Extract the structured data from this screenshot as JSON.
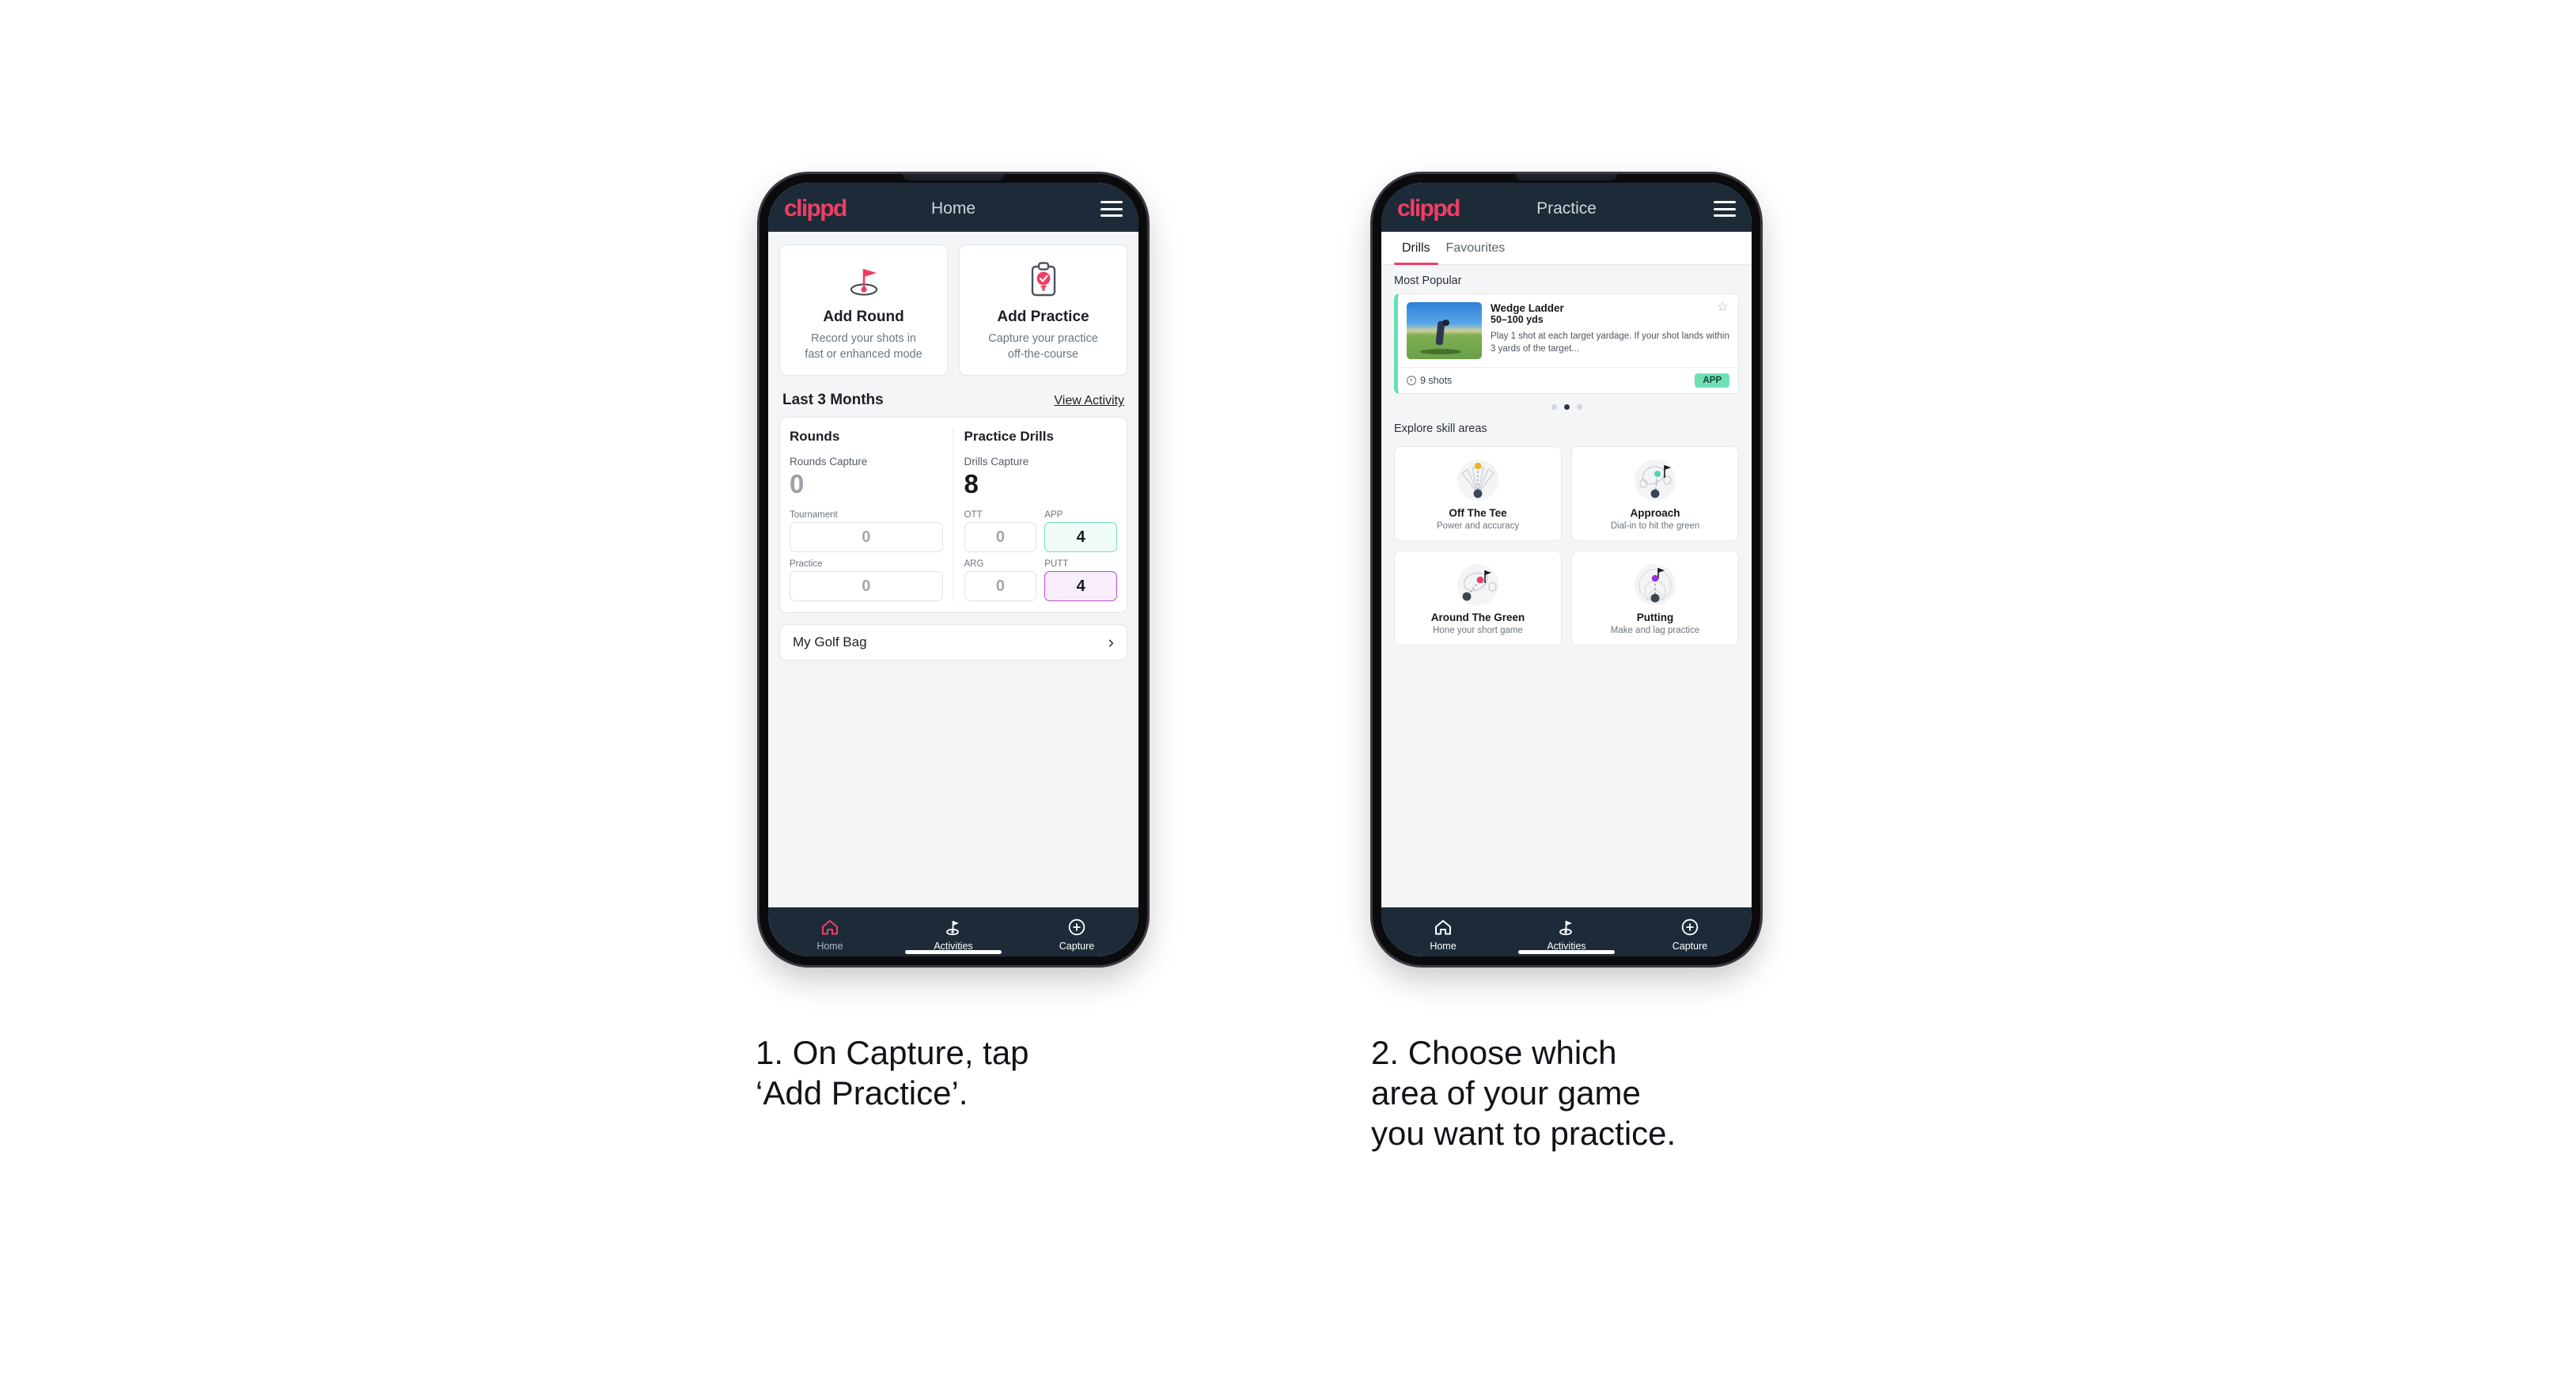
{
  "phone1": {
    "header": {
      "logo": "clippd",
      "title": "Home",
      "menu_icon": "hamburger-menu-icon"
    },
    "quick_actions": [
      {
        "icon": "golf-flag-icon",
        "title": "Add Round",
        "subtitle_line1": "Record your shots in",
        "subtitle_line2": "fast or enhanced mode"
      },
      {
        "icon": "clipboard-check-icon",
        "title": "Add Practice",
        "subtitle_line1": "Capture your practice",
        "subtitle_line2": "off-the-course"
      }
    ],
    "section": {
      "title": "Last 3 Months",
      "link": "View Activity"
    },
    "rounds": {
      "heading": "Rounds",
      "capture_label": "Rounds Capture",
      "capture_value": "0",
      "minis": [
        {
          "label": "Tournament",
          "value": "0",
          "state": "empty"
        },
        {
          "label": "Practice",
          "value": "0",
          "state": "empty"
        }
      ]
    },
    "drills": {
      "heading": "Practice Drills",
      "capture_label": "Drills Capture",
      "capture_value": "8",
      "minis": [
        {
          "label": "OTT",
          "value": "0",
          "state": "empty"
        },
        {
          "label": "APP",
          "value": "4",
          "state": "app"
        },
        {
          "label": "ARG",
          "value": "0",
          "state": "empty"
        },
        {
          "label": "PUTT",
          "value": "4",
          "state": "putt"
        }
      ]
    },
    "golf_bag": {
      "label": "My Golf Bag",
      "chevron": "chevron-right-icon"
    },
    "nav": [
      {
        "icon": "home-icon",
        "label": "Home",
        "active": true
      },
      {
        "icon": "golf-flag-icon",
        "label": "Activities",
        "active": false
      },
      {
        "icon": "plus-circle-icon",
        "label": "Capture",
        "active": false
      }
    ]
  },
  "phone2": {
    "header": {
      "logo": "clippd",
      "title": "Practice",
      "menu_icon": "hamburger-menu-icon"
    },
    "tabs": [
      {
        "label": "Drills",
        "active": true
      },
      {
        "label": "Favourites",
        "active": false
      }
    ],
    "most_popular_label": "Most Popular",
    "drill_card": {
      "thumbnail": "golfer-photo",
      "title": "Wedge Ladder",
      "yardage": "50–100 yds",
      "description": "Play 1 shot at each target yardage. If your shot lands within 3 yards of the target...",
      "favourite_icon": "star-outline-icon",
      "shots": "9 shots",
      "shots_icon": "clock-icon",
      "badge": "APP"
    },
    "carousel_dots": {
      "count": 3,
      "active_index": 1
    },
    "explore_label": "Explore skill areas",
    "skill_areas": [
      {
        "icon": "off-the-tee-icon",
        "name": "Off The Tee",
        "subtitle": "Power and accuracy",
        "dot_color": "#f4b223"
      },
      {
        "icon": "approach-icon",
        "name": "Approach",
        "subtitle": "Dial-in to hit the green",
        "dot_color": "#4fd6b0"
      },
      {
        "icon": "around-the-green-icon",
        "name": "Around The Green",
        "subtitle": "Hone your short game",
        "dot_color": "#ef3e63"
      },
      {
        "icon": "putting-icon",
        "name": "Putting",
        "subtitle": "Make and lag practice",
        "dot_color": "#9b2fd6"
      }
    ],
    "nav": [
      {
        "icon": "home-icon",
        "label": "Home",
        "active": false
      },
      {
        "icon": "golf-flag-icon",
        "label": "Activities",
        "active": false
      },
      {
        "icon": "plus-circle-icon",
        "label": "Capture",
        "active": false
      }
    ]
  },
  "captions": {
    "one_line1": "1. On Capture, tap",
    "one_line2": "‘Add Practice’.",
    "two_line1": "2. Choose which",
    "two_line2": "area of your game",
    "two_line3": "you want to practice."
  },
  "colors": {
    "brand_pink": "#ef3e63",
    "header_navy": "#1d2b38",
    "app_mint": "#6fe0b4",
    "putt_purple": "#b84ad0"
  }
}
